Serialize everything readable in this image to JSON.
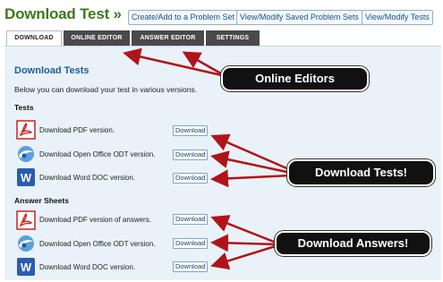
{
  "header": {
    "title": "Download Test »",
    "buttons": [
      "Create/Add to a Problem Set",
      "View/Modify Saved Problem Sets",
      "View/Modify Tests"
    ]
  },
  "tabs": [
    {
      "label": "DOWNLOAD",
      "active": true
    },
    {
      "label": "ONLINE EDITOR",
      "active": false
    },
    {
      "label": "ANSWER EDITOR",
      "active": false
    },
    {
      "label": "SETTINGS",
      "active": false
    }
  ],
  "main": {
    "heading": "Download Tests",
    "intro": "Below you can download your test in various versions.",
    "tests_section": {
      "title": "Tests",
      "rows": [
        {
          "label": "Download PDF version.",
          "button": "Download",
          "icon": "pdf-icon"
        },
        {
          "label": "Download Open Office ODT version.",
          "button": "Download",
          "icon": "openoffice-icon"
        },
        {
          "label": "Download Word DOC version.",
          "button": "Download",
          "icon": "word-icon"
        }
      ]
    },
    "answers_section": {
      "title": "Answer Sheets",
      "rows": [
        {
          "label": "Download PDF version of answers.",
          "button": "Download",
          "icon": "pdf-icon"
        },
        {
          "label": "Download Open Office ODT version.",
          "button": "Download",
          "icon": "openoffice-icon"
        },
        {
          "label": "Download Word DOC version.",
          "button": "Download",
          "icon": "word-icon"
        }
      ]
    }
  },
  "callouts": [
    "Online Editors",
    "Download Tests!",
    "Download Answers!"
  ],
  "colors": {
    "title_green": "#3b7a1a",
    "heading_blue": "#1c5c9e",
    "panel_bg": "#e9f2f8",
    "tab_dark": "#4a4a4a",
    "arrow_red": "#b0141a",
    "callout_bg": "#111111"
  }
}
